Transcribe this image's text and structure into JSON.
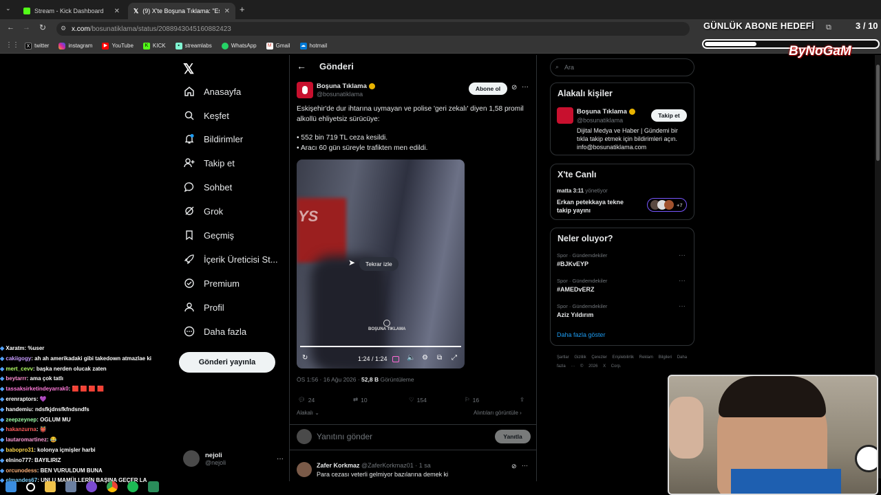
{
  "browser": {
    "tabs": [
      {
        "label": "Stream - Kick Dashboard",
        "icon": "kick-icon"
      },
      {
        "label": "(9) X'te Boşuna Tıklama: \"Eskişe",
        "icon": "x-icon"
      }
    ],
    "url_host": "x.com",
    "url_path": "/bosunatiklama/status/2088943045160882423",
    "bookmarks": [
      "twitter",
      "instagram",
      "YouTube",
      "KICK",
      "streamlabs",
      "WhatsApp",
      "Gmail",
      "hotmail"
    ]
  },
  "overlay": {
    "goal_title": "GÜNLÜK ABONE HEDEFİ",
    "goal_count": "3 / 10",
    "goal_progress": 0.3,
    "logo": "ByNoGaM"
  },
  "nav": {
    "items": [
      {
        "label": "Anasayfa",
        "icon": "home-icon"
      },
      {
        "label": "Keşfet",
        "icon": "search-icon"
      },
      {
        "label": "Bildirimler",
        "icon": "bell-icon"
      },
      {
        "label": "Takip et",
        "icon": "follow-icon"
      },
      {
        "label": "Sohbet",
        "icon": "chat-icon"
      },
      {
        "label": "Grok",
        "icon": "grok-icon"
      },
      {
        "label": "Geçmiş",
        "icon": "bookmark-icon"
      },
      {
        "label": "İçerik Üreticisi St...",
        "icon": "rocket-icon"
      },
      {
        "label": "Premium",
        "icon": "premium-icon"
      },
      {
        "label": "Profil",
        "icon": "profile-icon"
      },
      {
        "label": "Daha fazla",
        "icon": "more-icon"
      }
    ],
    "post_button": "Gönderi yayınla",
    "account_name": "nejoli",
    "account_handle": "@nejoli"
  },
  "post": {
    "page_title": "Gönderi",
    "author_name": "Boşuna Tıklama",
    "author_handle": "@bosunatiklama",
    "subscribe_label": "Abone ol",
    "text_1": "Eskişehir'de dur ihtarına uymayan ve polise 'geri zekalı' diyen 1,58 promil alkollü ehliyetsiz sürücüye:",
    "text_2": "• 552 bin 719 TL ceza kesildi.",
    "text_3": "• Aracı 60 gün süreyle trafikten men edildi.",
    "video": {
      "replay_label": "Tekrar izle",
      "watermark": "BOŞUNA TIKLAMA",
      "time": "1:24 / 1:24"
    },
    "meta_time": "ÖS 1:56 · 16 Ağu 2026 · ",
    "meta_views": "52,8 B",
    "meta_views_label": " Görüntüleme",
    "replies": "24",
    "reposts": "10",
    "likes": "154",
    "bookmarks": "16",
    "relevant_label": "Alakalı",
    "quotes_label": "Alıntıları görüntüle",
    "reply_placeholder": "Yanıtını gönder",
    "reply_button": "Yanıtla",
    "comment": {
      "name": "Zafer Korkmaz",
      "handle": "@ZaferKorkmaz01 · 1 sa",
      "text": "Para cezası veterli gelmiyor bazılarına demek ki"
    }
  },
  "sidebar": {
    "search_placeholder": "Ara",
    "related_title": "Alakalı kişiler",
    "related_name": "Boşuna Tıklama",
    "related_handle": "@bosunatiklama",
    "related_bio": "Dijital Medya ve Haber | Gündemi bir tıkla takip etmek için bildirimleri açın. info@bosunatiklama.com",
    "follow_label": "Takip et",
    "live_title": "X'te Canlı",
    "live_host": "matta 3:11",
    "live_role": " yönetiyor",
    "live_topic": "Erkan petekkaya tekne takip yayını",
    "live_count": "+7",
    "trends_title": "Neler oluyor?",
    "trends": [
      {
        "category": "Spor · Gündemdekiler",
        "name": "#BJKvEYP"
      },
      {
        "category": "Spor · Gündemdekiler",
        "name": "#AMEDvERZ"
      },
      {
        "category": "Spor · Gündemdekiler",
        "name": "Aziz Yıldırım"
      }
    ],
    "show_more": "Daha fazla göster",
    "footer": "Şartlar Gizlilik Çerezler Erişilebilirlik Reklam Bilgileri Daha fazla ··· © 2026 X Corp."
  },
  "chat": [
    {
      "user": "Xaratm",
      "msg": ": %user",
      "color": "#ffffff"
    },
    {
      "user": "cakiigogy",
      "msg": ": ah ah amerikadaki gibi takedown atmazlae ki",
      "color": "#c79bff"
    },
    {
      "user": "mert_cevv",
      "msg": ": başka nerden olucak zaten",
      "color": "#b3ff66"
    },
    {
      "user": "beytarrr",
      "msg": ": ama çok tatlı",
      "color": "#ff8fd1"
    },
    {
      "user": "tassaksirketindeyarrak0",
      "msg": ": 🟥 🟥 🟥 🟥",
      "color": "#ff7ad9"
    },
    {
      "user": "erenraptors",
      "msg": ": 💜",
      "color": "#ffffff"
    },
    {
      "user": "handemiu",
      "msg": ": ndsfkjdnsfkfndsndfs",
      "color": "#ffffff"
    },
    {
      "user": "zeepzeynep",
      "msg": ": OGLUM MU",
      "color": "#9effa8"
    },
    {
      "user": "hakanzurna",
      "msg": ": 👹",
      "color": "#ff5c5c"
    },
    {
      "user": "lautaromartinez",
      "msg": ": 😂",
      "color": "#ff9ad5"
    },
    {
      "user": "babopro31",
      "msg": ": kolonya içmişler harbi",
      "color": "#ffd84d"
    },
    {
      "user": "elnino777",
      "msg": ": BAYILIRIZ",
      "color": "#ffffff"
    },
    {
      "user": "orcunodess",
      "msg": ": BEN VURULDUM BUNA",
      "color": "#ffb27a"
    },
    {
      "user": "elmandes67",
      "msg": ": UNLU MAMÜLLERİN BAŞINA GEÇER LA",
      "color": "#7ad1ff"
    }
  ]
}
